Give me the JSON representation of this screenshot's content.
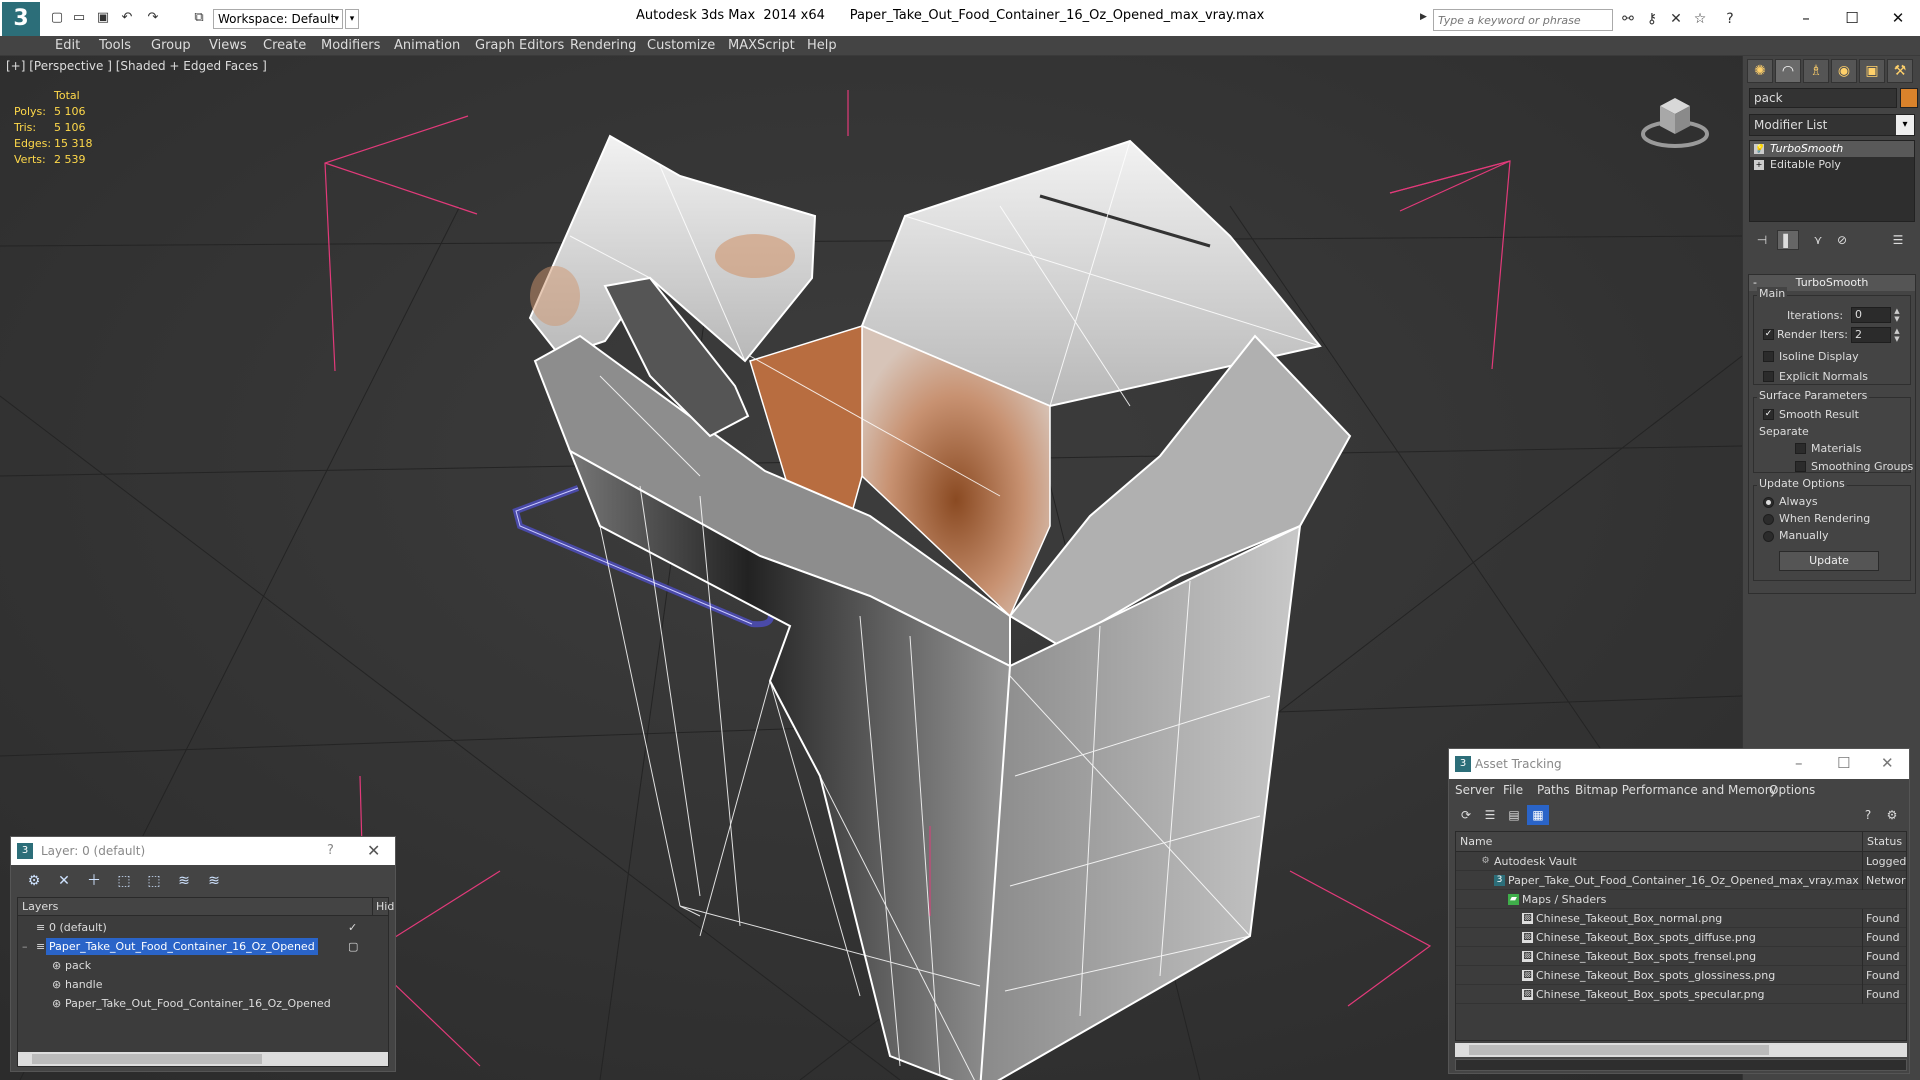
{
  "titlebar": {
    "app_title": "Autodesk 3ds Max  2014 x64",
    "file_title": "Paper_Take_Out_Food_Container_16_Oz_Opened_max_vray.max",
    "workspace": "Workspace: Default",
    "search_placeholder": "Type a keyword or phrase"
  },
  "menu": [
    "Edit",
    "Tools",
    "Group",
    "Views",
    "Create",
    "Modifiers",
    "Animation",
    "Graph Editors",
    "Rendering",
    "Customize",
    "MAXScript",
    "Help"
  ],
  "viewport": {
    "label": "[+] [Perspective ] [Shaded + Edged Faces ]",
    "stats": {
      "header": "Total",
      "rows": [
        {
          "k": "Polys:",
          "v": "5 106"
        },
        {
          "k": "Tris:",
          "v": "5 106"
        },
        {
          "k": "Edges:",
          "v": "15 318"
        },
        {
          "k": "Verts:",
          "v": "2 539"
        }
      ]
    }
  },
  "command_panel": {
    "object_name": "pack",
    "object_color": "#d9822b",
    "modifier_list": "Modifier List",
    "stack": [
      "TurboSmooth",
      "Editable Poly"
    ],
    "turbosmooth": {
      "title": "TurboSmooth",
      "main_label": "Main",
      "iterations_label": "Iterations:",
      "iterations": "0",
      "render_iters_label": "Render Iters:",
      "render_iters": "2",
      "isoline": "Isoline Display",
      "explicit_normals": "Explicit Normals",
      "surface_params": "Surface Parameters",
      "smooth_result": "Smooth Result",
      "separate": "Separate",
      "materials": "Materials",
      "smoothing_groups": "Smoothing Groups",
      "update_options": "Update Options",
      "always": "Always",
      "when_rendering": "When Rendering",
      "manually": "Manually",
      "update_btn": "Update"
    }
  },
  "layer_dialog": {
    "title": "Layer: 0 (default)",
    "help": "?",
    "col_layers": "Layers",
    "col_hide": "Hid",
    "rows": [
      {
        "name": "0 (default)",
        "indent": 1
      },
      {
        "name": "Paper_Take_Out_Food_Container_16_Oz_Opened",
        "indent": 1,
        "selected": true
      },
      {
        "name": "pack",
        "indent": 2
      },
      {
        "name": "handle",
        "indent": 2
      },
      {
        "name": "Paper_Take_Out_Food_Container_16_Oz_Opened",
        "indent": 2
      }
    ]
  },
  "asset_dialog": {
    "title": "Asset Tracking",
    "menu": [
      "Server",
      "File",
      "Paths",
      "Bitmap Performance and Memory",
      "Options"
    ],
    "col_name": "Name",
    "col_status": "Status",
    "rows": [
      {
        "name": "Autodesk Vault",
        "status": "Logged C",
        "indent": 1,
        "icon": "vault-icon"
      },
      {
        "name": "Paper_Take_Out_Food_Container_16_Oz_Opened_max_vray.max",
        "status": "Network I",
        "indent": 2,
        "icon": "max-file-icon"
      },
      {
        "name": "Maps / Shaders",
        "status": "",
        "indent": 3,
        "icon": "maps-icon"
      },
      {
        "name": "Chinese_Takeout_Box_normal.png",
        "status": "Found",
        "indent": 4,
        "icon": "bitmap-icon"
      },
      {
        "name": "Chinese_Takeout_Box_spots_diffuse.png",
        "status": "Found",
        "indent": 4,
        "icon": "bitmap-icon"
      },
      {
        "name": "Chinese_Takeout_Box_spots_frensel.png",
        "status": "Found",
        "indent": 4,
        "icon": "bitmap-icon"
      },
      {
        "name": "Chinese_Takeout_Box_spots_glossiness.png",
        "status": "Found",
        "indent": 4,
        "icon": "bitmap-icon"
      },
      {
        "name": "Chinese_Takeout_Box_spots_specular.png",
        "status": "Found",
        "indent": 4,
        "icon": "bitmap-icon"
      }
    ]
  }
}
